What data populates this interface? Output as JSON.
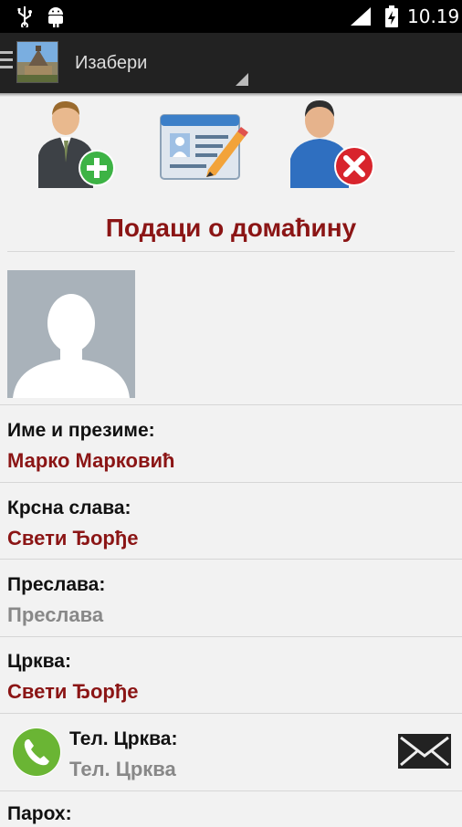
{
  "status_bar": {
    "time": "10.19",
    "icons": [
      "usb-icon",
      "android-icon",
      "signal-icon",
      "battery-charging-icon"
    ]
  },
  "action_bar": {
    "selector_label": "Изабери",
    "icons": [
      "menu-icon",
      "app-logo"
    ]
  },
  "toolbar": {
    "icons": [
      "add-user-icon",
      "edit-card-icon",
      "delete-user-icon"
    ]
  },
  "section": {
    "title": "Подаци о домаћину"
  },
  "fields": {
    "name": {
      "label": "Име и презиме:",
      "value": "Марко Марковић"
    },
    "slava": {
      "label": "Крсна слава:",
      "value": "Свети Ђорђе"
    },
    "preslava": {
      "label": "Преслава:",
      "value": "Преслава"
    },
    "church": {
      "label": "Црква:",
      "value": "Свети Ђорђе"
    },
    "church_phone": {
      "label": "Тел. Црква:",
      "value": "Тел. Црква"
    },
    "paroh": {
      "label": "Парох:"
    }
  },
  "colors": {
    "accent": "#8b1515",
    "placeholder": "#888888",
    "action_bar": "#222222",
    "background": "#f2f2f2"
  }
}
